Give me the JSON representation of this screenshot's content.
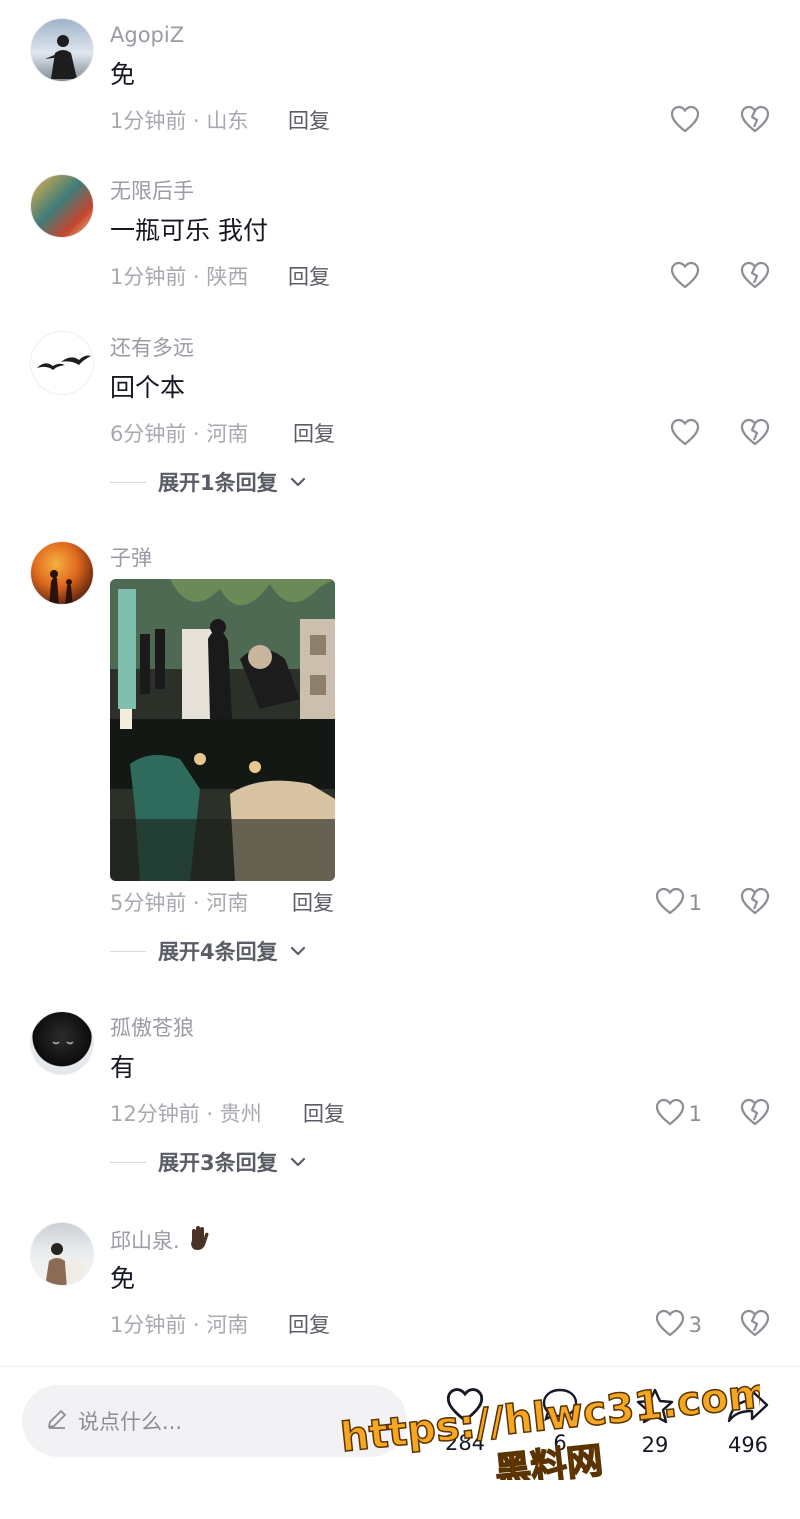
{
  "comments": [
    {
      "username": "AgopiZ",
      "text": "免",
      "time": "1分钟前",
      "location": "山东",
      "reply": "回复"
    },
    {
      "username": "无限后手",
      "text": "一瓶可乐 我付",
      "time": "1分钟前",
      "location": "陕西",
      "reply": "回复"
    },
    {
      "username": "还有多远",
      "text": "回个本",
      "time": "6分钟前",
      "location": "河南",
      "reply": "回复",
      "expand": "展开1条回复"
    },
    {
      "username": "子弹",
      "time": "5分钟前",
      "location": "河南",
      "reply": "回复",
      "likes": "1",
      "expand": "展开4条回复"
    },
    {
      "username": "孤傲苍狼",
      "text": "有",
      "time": "12分钟前",
      "location": "贵州",
      "reply": "回复",
      "likes": "1",
      "expand": "展开3条回复"
    },
    {
      "username": "邱山泉.",
      "text": "免",
      "time": "1分钟前",
      "location": "河南",
      "reply": "回复",
      "likes": "3"
    }
  ],
  "separator": " · ",
  "bottom_bar": {
    "input_placeholder": "说点什么...",
    "like_count": "284",
    "comment_count": "6",
    "favorite_count": "29",
    "share_count": "496"
  },
  "watermark": {
    "url": "https://hlwc31.com",
    "name": "黑料网"
  },
  "icons": {
    "like": "heart-outline-icon",
    "dislike": "broken-heart-icon",
    "edit": "pencil-icon",
    "favorite": "star-outline-icon",
    "share": "share-arrow-icon",
    "expand": "chevron-down-icon"
  }
}
